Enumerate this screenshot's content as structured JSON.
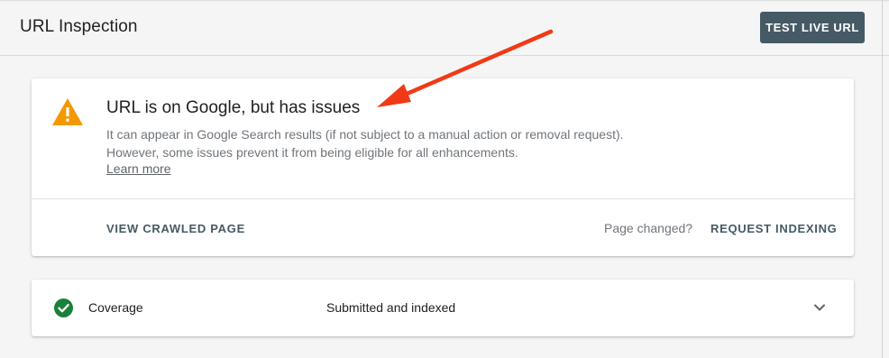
{
  "header": {
    "title": "URL Inspection",
    "test_live_url_label": "TEST LIVE URL"
  },
  "status": {
    "icon": "warning-triangle-icon",
    "title": "URL is on Google, but has issues",
    "description": "It can appear in Google Search results (if not subject to a manual action or removal request). However, some issues prevent it from being eligible for all enhancements.",
    "learn_more": "Learn more",
    "view_crawled_page": "VIEW CRAWLED PAGE",
    "page_changed": "Page changed?",
    "request_indexing": "REQUEST INDEXING"
  },
  "coverage": {
    "icon": "check-circle-icon",
    "label": "Coverage",
    "value": "Submitted and indexed",
    "expand_icon": "chevron-down-icon"
  },
  "colors": {
    "warning": "#f29900",
    "success": "#188038",
    "button_bg": "#455a64",
    "annotation_arrow": "#f03a17"
  }
}
